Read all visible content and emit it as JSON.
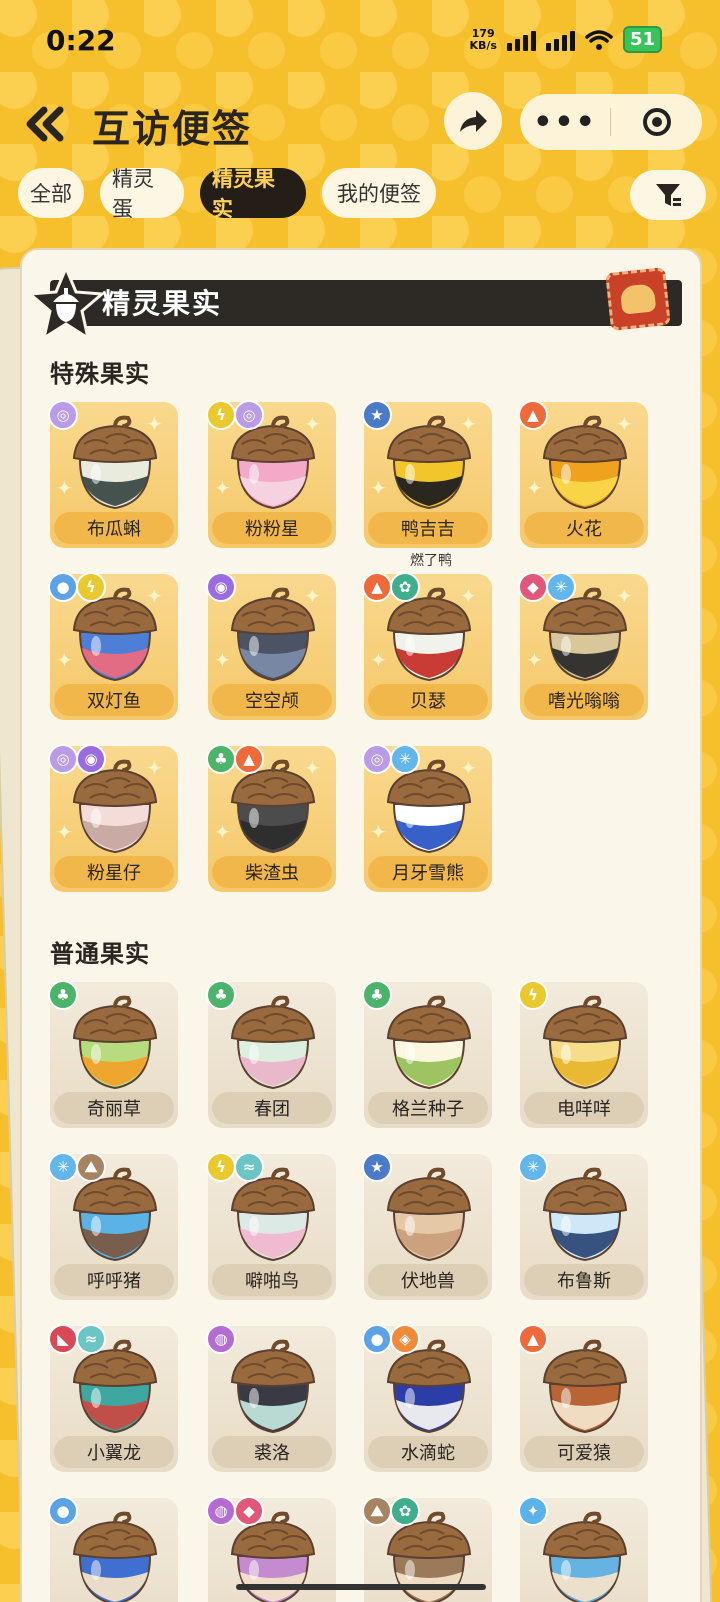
{
  "status": {
    "time": "0:22",
    "net_speed_value": "179",
    "net_speed_unit": "KB/s",
    "battery": "51"
  },
  "header": {
    "title": "互访便签",
    "more_label": "•••"
  },
  "tabs": [
    {
      "label": "全部",
      "active": false
    },
    {
      "label": "精灵蛋",
      "active": false
    },
    {
      "label": "精灵果实",
      "active": true
    },
    {
      "label": "我的便签",
      "active": false
    }
  ],
  "card": {
    "banner_title": "精灵果实"
  },
  "sections": {
    "special_title": "特殊果实",
    "normal_title": "普通果实"
  },
  "special_items": [
    {
      "name": "布瓜蝌",
      "types": [
        "psychic"
      ],
      "colors": [
        "#e9ecdc",
        "#3d4a46"
      ]
    },
    {
      "name": "粉粉星",
      "types": [
        "electric",
        "psychic"
      ],
      "colors": [
        "#f3a9c7",
        "#f5d3e2"
      ]
    },
    {
      "name": "鸭吉吉",
      "types": [
        "normal"
      ],
      "colors": [
        "#f2c62a",
        "#1f1f1f"
      ]
    },
    {
      "name": "火花",
      "types": [
        "fire"
      ],
      "colors": [
        "#f0a21f",
        "#f9d74a"
      ]
    },
    {
      "name": "双灯鱼",
      "types": [
        "water",
        "electric"
      ],
      "colors": [
        "#4d7fd6",
        "#e96b7e"
      ]
    },
    {
      "name": "空空颅",
      "types": [
        "ghost"
      ],
      "colors": [
        "#4b5364",
        "#7a8aa8"
      ]
    },
    {
      "name": "贝瑟",
      "types": [
        "fire",
        "mechanical"
      ],
      "colors": [
        "#f2f2ec",
        "#c6302b"
      ]
    },
    {
      "name": "嗜光嗡嗡",
      "types": [
        "demon",
        "ice"
      ],
      "colors": [
        "#d9c79b",
        "#2d2c2a"
      ]
    },
    {
      "name": "粉星仔",
      "types": [
        "psychic",
        "ghost"
      ],
      "colors": [
        "#f4dcd9",
        "#c7a6a1"
      ]
    },
    {
      "name": "柴渣虫",
      "types": [
        "grass",
        "fire"
      ],
      "colors": [
        "#4c4c4c",
        "#2c2c2c"
      ]
    },
    {
      "name": "月牙雪熊",
      "types": [
        "psychic",
        "ice"
      ],
      "colors": [
        "#ffffff",
        "#2c58c6"
      ]
    }
  ],
  "special_note": "燃了鸭",
  "normal_items": [
    {
      "name": "奇丽草",
      "types": [
        "grass"
      ],
      "colors": [
        "#b7db7e",
        "#f0a32a"
      ]
    },
    {
      "name": "春团",
      "types": [
        "grass"
      ],
      "colors": [
        "#dceedd",
        "#e9b4c9"
      ]
    },
    {
      "name": "格兰种子",
      "types": [
        "grass"
      ],
      "colors": [
        "#fbf6df",
        "#98c15a"
      ]
    },
    {
      "name": "电咩咩",
      "types": [
        "electric"
      ],
      "colors": [
        "#f7dc8a",
        "#e9b62f"
      ]
    },
    {
      "name": "呼呼猪",
      "types": [
        "ice",
        "ground"
      ],
      "colors": [
        "#5ab3e4",
        "#7b5a46"
      ]
    },
    {
      "name": "噼啪鸟",
      "types": [
        "electric",
        "wind"
      ],
      "colors": [
        "#dde9e4",
        "#f0b7cf"
      ]
    },
    {
      "name": "伏地兽",
      "types": [
        "normal"
      ],
      "colors": [
        "#e5c8a5",
        "#c9a07a"
      ]
    },
    {
      "name": "布鲁斯",
      "types": [
        "ice"
      ],
      "colors": [
        "#cfe8f7",
        "#2f4a78"
      ]
    },
    {
      "name": "小翼龙",
      "types": [
        "dragon",
        "wind"
      ],
      "colors": [
        "#3ea7a0",
        "#c84a45"
      ]
    },
    {
      "name": "裘洛",
      "types": [
        "poison"
      ],
      "colors": [
        "#3a3a44",
        "#bfe3da"
      ]
    },
    {
      "name": "水滴蛇",
      "types": [
        "water",
        "fighting"
      ],
      "colors": [
        "#2c3da7",
        "#f2f2f2"
      ]
    },
    {
      "name": "可爱猿",
      "types": [
        "fire"
      ],
      "colors": [
        "#b86434",
        "#f2e3c9"
      ]
    },
    {
      "name": "",
      "types": [
        "water"
      ],
      "colors": [
        "#3f6fd0",
        "#f2e3c9"
      ]
    },
    {
      "name": "",
      "types": [
        "poison",
        "demon"
      ],
      "colors": [
        "#c48ccf",
        "#f2e3c9"
      ]
    },
    {
      "name": "",
      "types": [
        "ground",
        "mechanical"
      ],
      "colors": [
        "#9b7a5a",
        "#f2e3c9"
      ]
    },
    {
      "name": "",
      "types": [
        "light"
      ],
      "colors": [
        "#65b3e3",
        "#f2e3c9"
      ]
    }
  ],
  "type_colors": {
    "psychic": "#b99be6",
    "electric": "#e9c92e",
    "normal": "#4b7bc8",
    "fire": "#ef6a3a",
    "water": "#5ba3e5",
    "ghost": "#9b6be0",
    "mechanical": "#3fae8d",
    "demon": "#e0577a",
    "ice": "#63b6ea",
    "grass": "#4cb36b",
    "ground": "#a68462",
    "wind": "#6ac5c4",
    "dragon": "#d94855",
    "poison": "#b56bd4",
    "fighting": "#ef8a3a",
    "light": "#5ab2e8"
  },
  "type_glyphs": {
    "psychic": "◎",
    "electric": "ϟ",
    "normal": "★",
    "fire": "▲",
    "water": "●",
    "ghost": "◉",
    "mechanical": "✿",
    "demon": "◆",
    "ice": "✳",
    "grass": "♣",
    "ground": "⛰",
    "wind": "≈",
    "dragon": "◣",
    "poison": "◍",
    "fighting": "◈",
    "light": "✦"
  }
}
